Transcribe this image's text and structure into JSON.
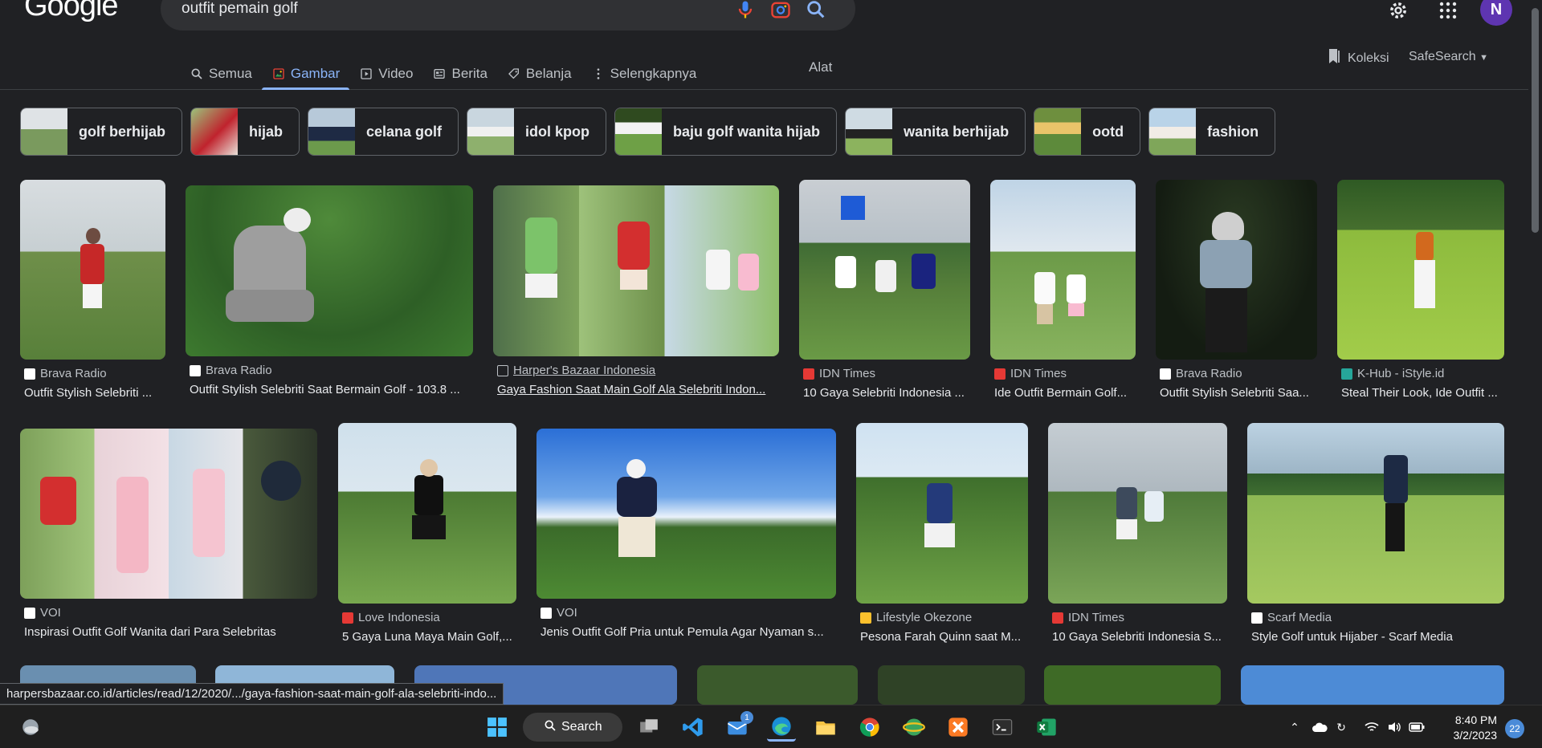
{
  "header": {
    "logo": "Google",
    "query": "outfit pemain golf",
    "avatar_letter": "N"
  },
  "tabs": [
    {
      "label": "Semua",
      "icon": "search-icon"
    },
    {
      "label": "Gambar",
      "icon": "image-icon",
      "active": true
    },
    {
      "label": "Video",
      "icon": "video-icon"
    },
    {
      "label": "Berita",
      "icon": "news-icon"
    },
    {
      "label": "Belanja",
      "icon": "tag-icon"
    },
    {
      "label": "Selengkapnya",
      "icon": "more-vert-icon"
    }
  ],
  "tools_label": "Alat",
  "koleksi_label": "Koleksi",
  "safesearch_label": "SafeSearch",
  "chips": [
    {
      "label": "golf berhijab"
    },
    {
      "label": "hijab"
    },
    {
      "label": "celana golf"
    },
    {
      "label": "idol kpop"
    },
    {
      "label": "baju golf wanita hijab"
    },
    {
      "label": "wanita berhijab"
    },
    {
      "label": "ootd"
    },
    {
      "label": "fashion"
    }
  ],
  "results": [
    {
      "source": "Brava Radio",
      "title": "Outfit Stylish Selebriti ...",
      "fav_color": "#ffffff"
    },
    {
      "source": "Brava Radio",
      "title": "Outfit Stylish Selebriti Saat Bermain Golf - 103.8 ...",
      "fav_color": "#ffffff"
    },
    {
      "source": "Harper's Bazaar Indonesia",
      "title": "Gaya Fashion Saat Main Golf Ala Selebriti Indon...",
      "fav_color": "#202124"
    },
    {
      "source": "IDN Times",
      "title": "10 Gaya Selebriti Indonesia ...",
      "fav_color": "#e53935"
    },
    {
      "source": "IDN Times",
      "title": "Ide Outfit Bermain Golf...",
      "fav_color": "#e53935"
    },
    {
      "source": "Brava Radio",
      "title": "Outfit Stylish Selebriti Saa...",
      "fav_color": "#ffffff"
    },
    {
      "source": "K-Hub - iStyle.id",
      "title": "Steal Their Look, Ide Outfit ...",
      "fav_color": "#26a69a"
    },
    {
      "source": "VOI",
      "title": "Inspirasi Outfit Golf Wanita dari Para Selebritas",
      "fav_color": "#ffffff"
    },
    {
      "source": "Love Indonesia",
      "title": "5 Gaya Luna Maya Main Golf,...",
      "fav_color": "#e53935"
    },
    {
      "source": "VOI",
      "title": "Jenis Outfit Golf Pria untuk Pemula Agar Nyaman s...",
      "fav_color": "#ffffff"
    },
    {
      "source": "Lifestyle Okezone",
      "title": "Pesona Farah Quinn saat M...",
      "fav_color": "#fbc02d"
    },
    {
      "source": "IDN Times",
      "title": "10 Gaya Selebriti Indonesia S...",
      "fav_color": "#e53935"
    },
    {
      "source": "Scarf Media",
      "title": "Style Golf untuk Hijaber - Scarf Media",
      "fav_color": "#ffffff"
    }
  ],
  "status_url": "harpersbazaar.co.id/articles/read/12/2020/.../gaya-fashion-saat-main-golf-ala-selebriti-indo...",
  "taskbar": {
    "search_label": "Search",
    "time": "8:40 PM",
    "date": "3/2/2023",
    "notification_count": "22",
    "mail_badge": "1"
  }
}
